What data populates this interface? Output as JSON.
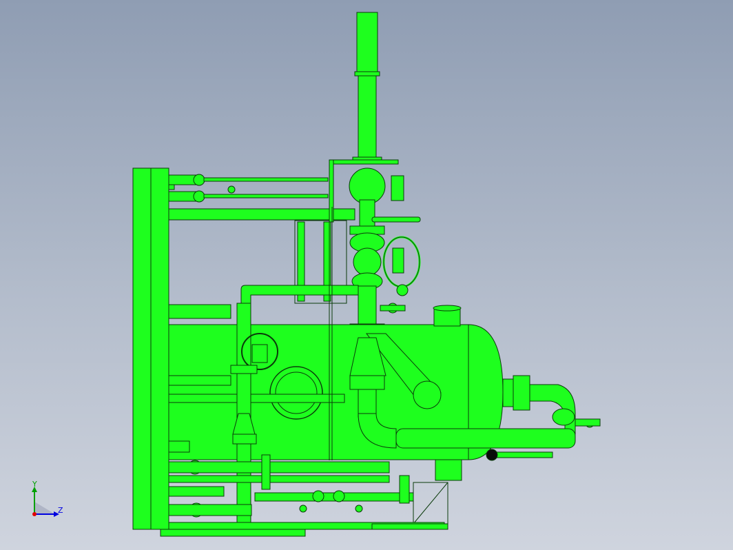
{
  "colors": {
    "background_top": "#8f9db3",
    "background_bottom": "#cfd4de",
    "model_fill": "#1eff1e",
    "model_edge": "#0a3a0a",
    "x_axis": "#e00000",
    "y_axis": "#00a000",
    "z_axis": "#0000e0"
  },
  "triad": {
    "y_label": "Y",
    "z_label": "Z"
  }
}
